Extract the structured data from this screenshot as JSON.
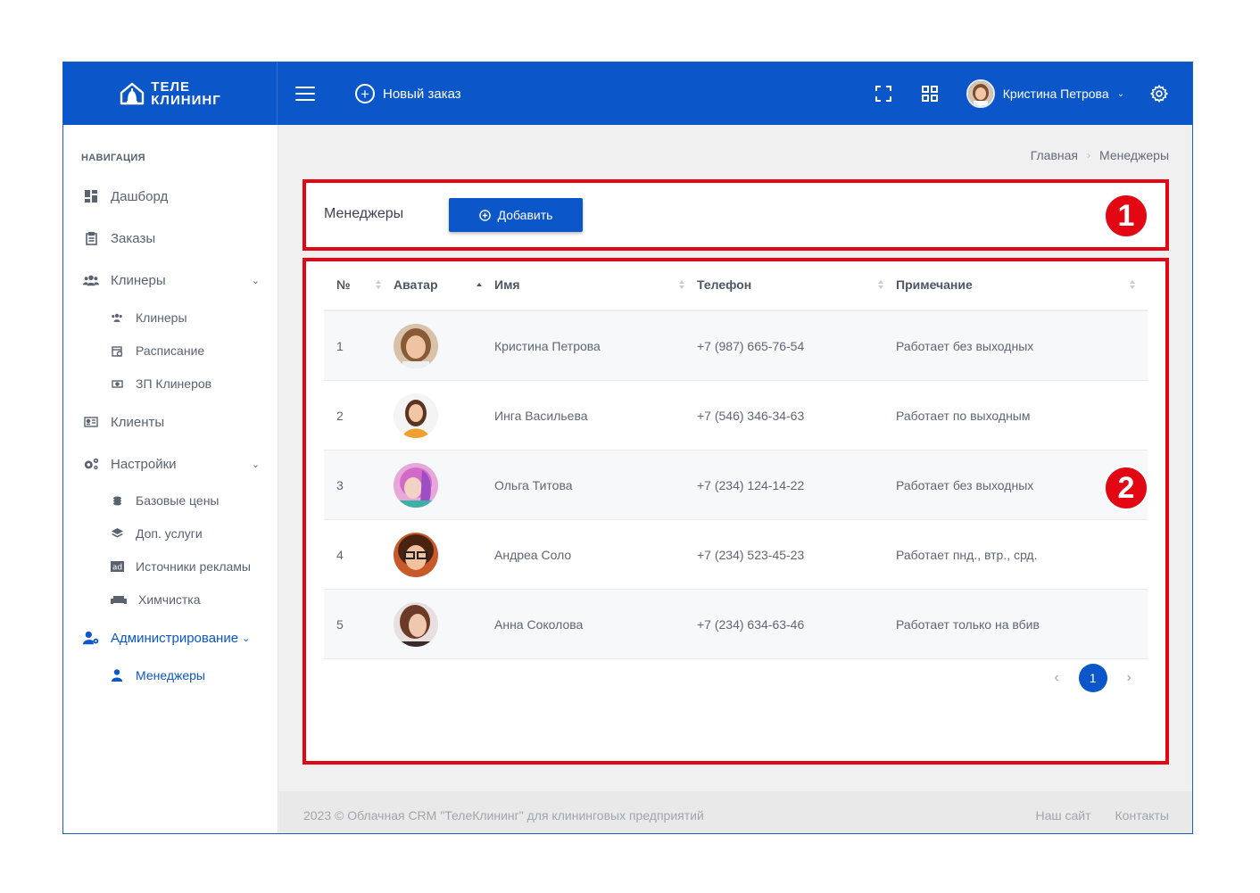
{
  "header": {
    "logo_line1": "ТЕЛЕ",
    "logo_line2": "КЛИНИНГ",
    "new_order_label": "Новый заказ",
    "user_name": "Кристина Петрова",
    "accent": "#0b56c8"
  },
  "sidebar": {
    "nav_title": "НАВИГАЦИЯ",
    "items": {
      "dashboard": "Дашборд",
      "orders": "Заказы",
      "cleaners": "Клинеры",
      "cleaners_sub": "Клинеры",
      "schedule": "Расписание",
      "salary": "ЗП Клинеров",
      "clients": "Клиенты",
      "settings": "Настройки",
      "base_prices": "Базовые цены",
      "extra_services": "Доп. услуги",
      "ad_sources": "Источники рекламы",
      "dry_cleaning": "Химчистка",
      "admin": "Администрирование",
      "managers": "Менеджеры"
    }
  },
  "breadcrumb": {
    "home": "Главная",
    "current": "Менеджеры"
  },
  "page": {
    "title": "Менеджеры",
    "add_label": "Добавить"
  },
  "table": {
    "columns": [
      "№",
      "Аватар",
      "Имя",
      "Телефон",
      "Примечание"
    ],
    "rows": [
      {
        "num": "1",
        "name": "Кристина Петрова",
        "phone": "+7 (987) 665-76-54",
        "note": "Работает без выходных"
      },
      {
        "num": "2",
        "name": "Инга Васильева",
        "phone": "+7 (546) 346-34-63",
        "note": "Работает по выходным"
      },
      {
        "num": "3",
        "name": "Ольга Титова",
        "phone": "+7 (234) 124-14-22",
        "note": "Работает без выходных"
      },
      {
        "num": "4",
        "name": "Андреа Соло",
        "phone": "+7 (234) 523-45-23",
        "note": "Работает пнд., втр., срд."
      },
      {
        "num": "5",
        "name": "Анна Соколова",
        "phone": "+7 (234) 634-63-46",
        "note": "Работает только на вбив"
      }
    ]
  },
  "pagination": {
    "current_page": "1",
    "prev": "‹",
    "next": "›"
  },
  "footer": {
    "copyright": "2023 © Облачная CRM \"ТелеКлининг\" для клининговых предприятий",
    "link_site": "Наш сайт",
    "link_contacts": "Контакты"
  },
  "annotations": {
    "badge1": "1",
    "badge2": "2",
    "color": "#e30613"
  }
}
